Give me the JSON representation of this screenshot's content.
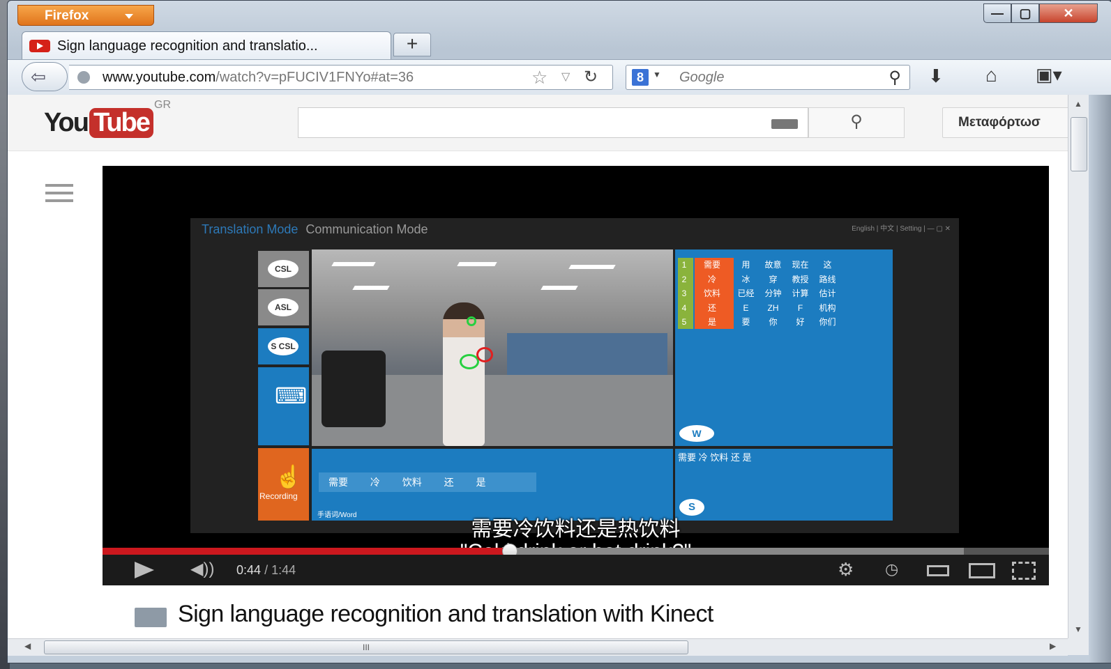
{
  "browser": {
    "menu_label": "Firefox",
    "window_controls": {
      "minimize": "—",
      "maximize": "▢",
      "close": "✕"
    },
    "tab": {
      "title": "Sign language recognition and translatio...",
      "new_tab": "+"
    },
    "nav": {
      "url_domain": "www.youtube.com",
      "url_path": "/watch?v=pFUCIV1FNYo#at=36",
      "search_engine_letter": "8",
      "search_placeholder": "Google"
    }
  },
  "youtube": {
    "logo_you": "You",
    "logo_tube": "Tube",
    "region": "GR",
    "upload_label": "Μεταφόρτωσ"
  },
  "video": {
    "app": {
      "title_active": "Translation Mode",
      "title_inactive": "Communication Mode",
      "window_controls": "English | 中文 |   Setting   | — ▢ ✕",
      "mode_tiles": {
        "csl": "CSL",
        "asl": "ASL",
        "scsl": "S CSL",
        "recording": "Recording"
      },
      "word_rows": [
        [
          "1",
          "需要",
          "用",
          "故意",
          "现在",
          "这"
        ],
        [
          "2",
          "冷",
          "冰",
          "穿",
          "教授",
          "路线"
        ],
        [
          "3",
          "饮料",
          "已经",
          "分钟",
          "计算",
          "估计"
        ],
        [
          "4",
          "还",
          "E",
          "ZH",
          "F",
          "机构"
        ],
        [
          "5",
          "是",
          "要",
          "你",
          "好",
          "你们"
        ]
      ],
      "w_badge": "W",
      "sentence_words": "需要 冷 饮料 还 是",
      "footer": "手语词/Word",
      "output_text": "需要 冷 饮料 还 是",
      "s_badge": "S"
    },
    "subtitle_zh": "需要冷饮料还是热饮料",
    "subtitle_en": "\"Cold drink or hot drink?\"",
    "progress": {
      "played_fraction": 0.43,
      "buffered_fraction": 0.91
    },
    "time_current": "0:44",
    "time_separator": "/",
    "time_total": "1:44",
    "title": "Sign language recognition and translation with Kinect"
  },
  "scrollbar": {
    "h_grip": "III"
  }
}
